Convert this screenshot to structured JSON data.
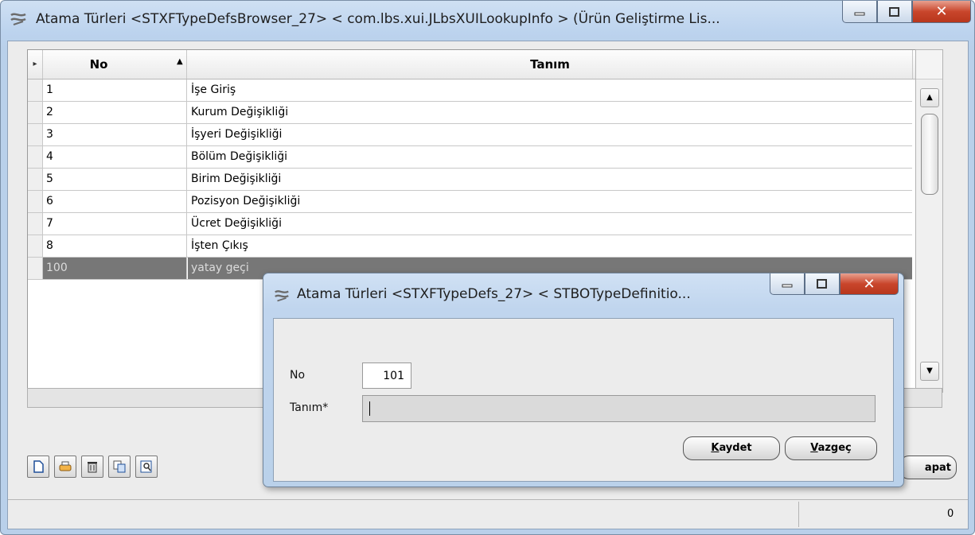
{
  "window": {
    "title": "Atama Türleri <STXFTypeDefsBrowser_27> < com.lbs.xui.JLbsXUILookupInfo > (Ürün Geliştirme Lis..."
  },
  "grid": {
    "columns": [
      "No",
      "Tanım"
    ],
    "rows": [
      {
        "no": "1",
        "tanim": "İşe Giriş"
      },
      {
        "no": "2",
        "tanim": "Kurum Değişikliği"
      },
      {
        "no": "3",
        "tanim": "İşyeri Değişikliği"
      },
      {
        "no": "4",
        "tanim": "Bölüm Değişikliği"
      },
      {
        "no": "5",
        "tanim": "Birim Değişikliği"
      },
      {
        "no": "6",
        "tanim": "Pozisyon Değişikliği"
      },
      {
        "no": "7",
        "tanim": "Ücret Değişikliği"
      },
      {
        "no": "8",
        "tanim": "İşten Çıkış"
      },
      {
        "no": "100",
        "tanim": "yatay geçi"
      }
    ],
    "selected_row": "100"
  },
  "toolbar": {
    "icons": [
      "new-document-icon",
      "print-icon",
      "delete-icon",
      "copy-icon",
      "preview-icon"
    ],
    "kapat_label": "apat"
  },
  "statusbar": {
    "count": "0"
  },
  "dialog": {
    "title": "Atama Türleri <STXFTypeDefs_27> < STBOTypeDefinitio...",
    "no_label": "No",
    "no_value": "101",
    "tanim_label": "Tanım*",
    "tanim_value": "",
    "save_label_underlined": "K",
    "save_label_rest": "aydet",
    "cancel_label_underlined": "V",
    "cancel_label_rest": "azgeç"
  }
}
